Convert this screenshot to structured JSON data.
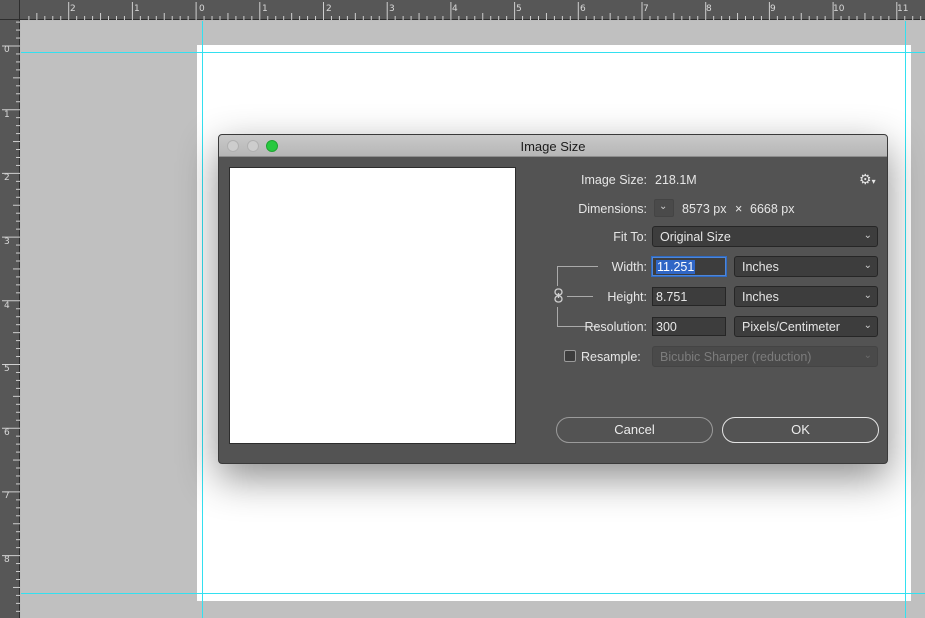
{
  "rulers": {
    "top_labels": [
      "2",
      "1",
      "0",
      "1",
      "2",
      "3",
      "4",
      "5",
      "6",
      "7",
      "8",
      "9",
      "10",
      "11"
    ],
    "left_labels": [
      "0",
      "1",
      "2",
      "3",
      "4",
      "5",
      "6",
      "7",
      "8"
    ]
  },
  "dialog": {
    "title": "Image Size",
    "image_size_label": "Image Size:",
    "image_size_value": "218.1M",
    "dimensions_label": "Dimensions:",
    "dimensions_width": "8573 px",
    "dimensions_x": "×",
    "dimensions_height": "6668 px",
    "fit_to_label": "Fit To:",
    "fit_to_value": "Original Size",
    "width_label": "Width:",
    "width_value": "11.251",
    "width_unit": "Inches",
    "height_label": "Height:",
    "height_value": "8.751",
    "height_unit": "Inches",
    "resolution_label": "Resolution:",
    "resolution_value": "300",
    "resolution_unit": "Pixels/Centimeter",
    "resample_label": "Resample:",
    "resample_checked": false,
    "resample_method": "Bicubic Sharper (reduction)",
    "cancel_label": "Cancel",
    "ok_label": "OK"
  },
  "icons": {
    "gear": "gear-icon",
    "link": "chain-link-icon",
    "chevron": "chevron-down-icon"
  },
  "colors": {
    "dialog_bg": "#535353",
    "field_bg": "#3d3d3d",
    "selection": "#2f66c6",
    "guide": "#33e0f0",
    "zoom_button": "#27c93f"
  }
}
